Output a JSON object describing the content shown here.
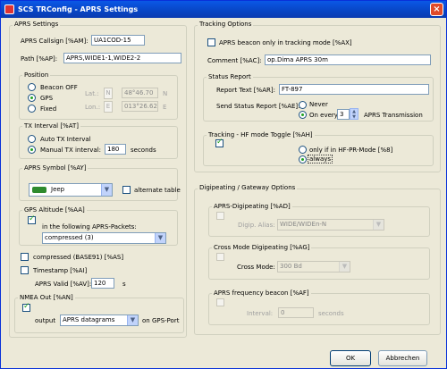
{
  "window": {
    "title": "SCS TRConfig - APRS Settings",
    "close": "×"
  },
  "aprs": {
    "group": "APRS Settings",
    "callsign_label": "APRS Callsign [%AM]:",
    "callsign": "UA1COD-15",
    "path_label": "Path [%AP]:",
    "path": "APRS,WIDE1-1,WIDE2-2",
    "position": {
      "group": "Position",
      "beacon_off": "Beacon OFF",
      "gps": "GPS",
      "fixed": "Fixed",
      "selected": "GPS",
      "lat_label": "Lat.:",
      "lat_dir": "N",
      "lat": "48°46.70",
      "lat_dir_right": "N",
      "lon_label": "Lon.:",
      "lon_dir": "E",
      "lon": "013°26.62",
      "lon_dir_right": "E"
    },
    "tx_interval": {
      "group": "TX Interval [%AT]",
      "auto": "Auto TX Interval",
      "manual": "Manual TX interval:",
      "selected": "Manual TX interval:",
      "seconds": "180",
      "unit": "seconds"
    },
    "symbol": {
      "group": "APRS Symbol [%AY]",
      "value": "Jeep",
      "alt_table": "alternate table",
      "alt_table_checked": false
    },
    "gps_alt": {
      "group": "GPS Altitude [%AA]",
      "checked": true,
      "in_packets": "in the following APRS-Packets:",
      "packets_value": "compressed (3)"
    },
    "compressed_label": "compressed (BASE91) [%AS]",
    "compressed_checked": false,
    "timestamp_label": "Timestamp [%AI]",
    "timestamp_checked": false,
    "valid_label": "APRS Valid [%AV]:",
    "valid_value": "120",
    "valid_unit": "s",
    "nmea": {
      "group": "NMEA Out [%AN]",
      "checked": true,
      "output_label": "output",
      "output_value": "APRS datagrams",
      "port_label": "on GPS-Port"
    }
  },
  "tracking": {
    "group": "Tracking Options",
    "beacon_only_label": "APRS beacon only in tracking mode [%AX]",
    "beacon_only_checked": false,
    "comment_label": "Comment [%AC]:",
    "comment": "op.Dima APRS 30m",
    "status": {
      "group": "Status Report",
      "text_label": "Report Text [%AR]:",
      "text": "FT-897",
      "send_label": "Send Status Report [%AE]:",
      "never": "Never",
      "on_every": "On every",
      "count": "3",
      "tx_label": "APRS Transmission",
      "selected": "On every"
    },
    "hf_toggle": {
      "group": "Tracking - HF mode Toggle [%AH]",
      "checked": true,
      "only_if": "only if in HF-PR-Mode [%8]",
      "always": "always",
      "selected": "always"
    }
  },
  "digi": {
    "group": "Digipeating / Gateway Options",
    "aprs_digi": {
      "group": "APRS-Digipeating [%AD]",
      "checked": false,
      "alias_label": "Digip. Alias:",
      "alias_value": "WIDE/WIDEn-N"
    },
    "cross": {
      "group": "Cross Mode Digipeating [%AG]",
      "checked": false,
      "mode_label": "Cross Mode:",
      "mode_value": "300 Bd"
    },
    "freq_beacon": {
      "group": "APRS frequency beacon [%AF]",
      "checked": false,
      "interval_label": "Interval:",
      "interval_value": "0",
      "interval_unit": "seconds"
    }
  },
  "buttons": {
    "ok": "OK",
    "cancel": "Abbrechen"
  },
  "colors": {
    "titlebar": "#0a58e6",
    "face": "#ece9d8",
    "check": "#21a121"
  },
  "icons": {
    "app": "app-icon",
    "symbol": "jeep-icon"
  }
}
